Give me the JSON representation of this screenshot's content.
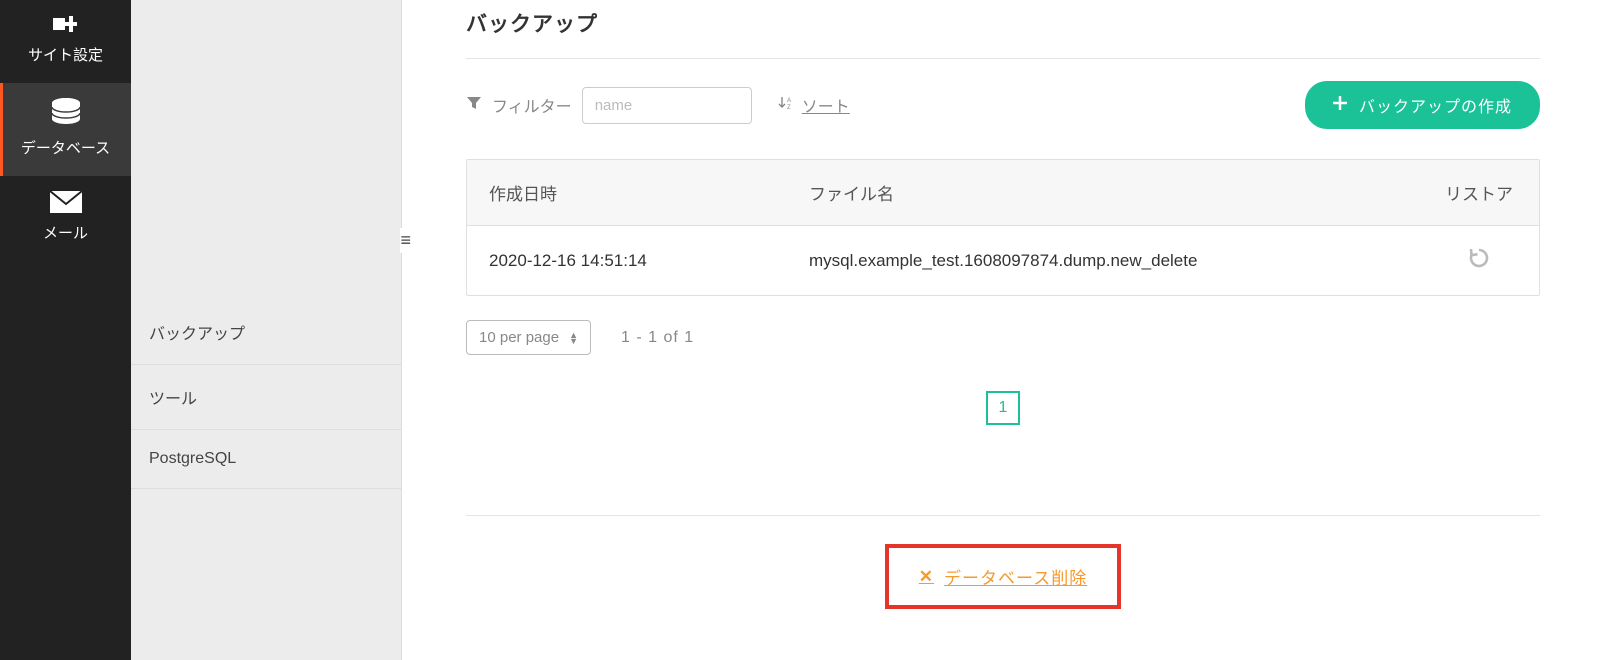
{
  "sidebar": {
    "primary": [
      {
        "label": "サイト設定",
        "icon": "site-settings"
      },
      {
        "label": "データベース",
        "icon": "database"
      },
      {
        "label": "メール",
        "icon": "mail"
      }
    ],
    "secondary": [
      {
        "label": "バックアップ"
      },
      {
        "label": "ツール"
      },
      {
        "label": "PostgreSQL"
      }
    ]
  },
  "page": {
    "title": "バックアップ"
  },
  "toolbar": {
    "filter_label": "フィルター",
    "filter_placeholder": "name",
    "sort_label": "ソート",
    "create_label": "バックアップの作成"
  },
  "table": {
    "headers": {
      "created": "作成日時",
      "filename": "ファイル名",
      "restore": "リストア"
    },
    "rows": [
      {
        "created": "2020-12-16 14:51:14",
        "filename": "mysql.example_test.1608097874.dump.new_delete"
      }
    ]
  },
  "pagination": {
    "per_page_label": "10 per page",
    "range_text": "1 - 1 of 1",
    "pages": [
      "1"
    ]
  },
  "delete": {
    "label": "データベース削除"
  }
}
